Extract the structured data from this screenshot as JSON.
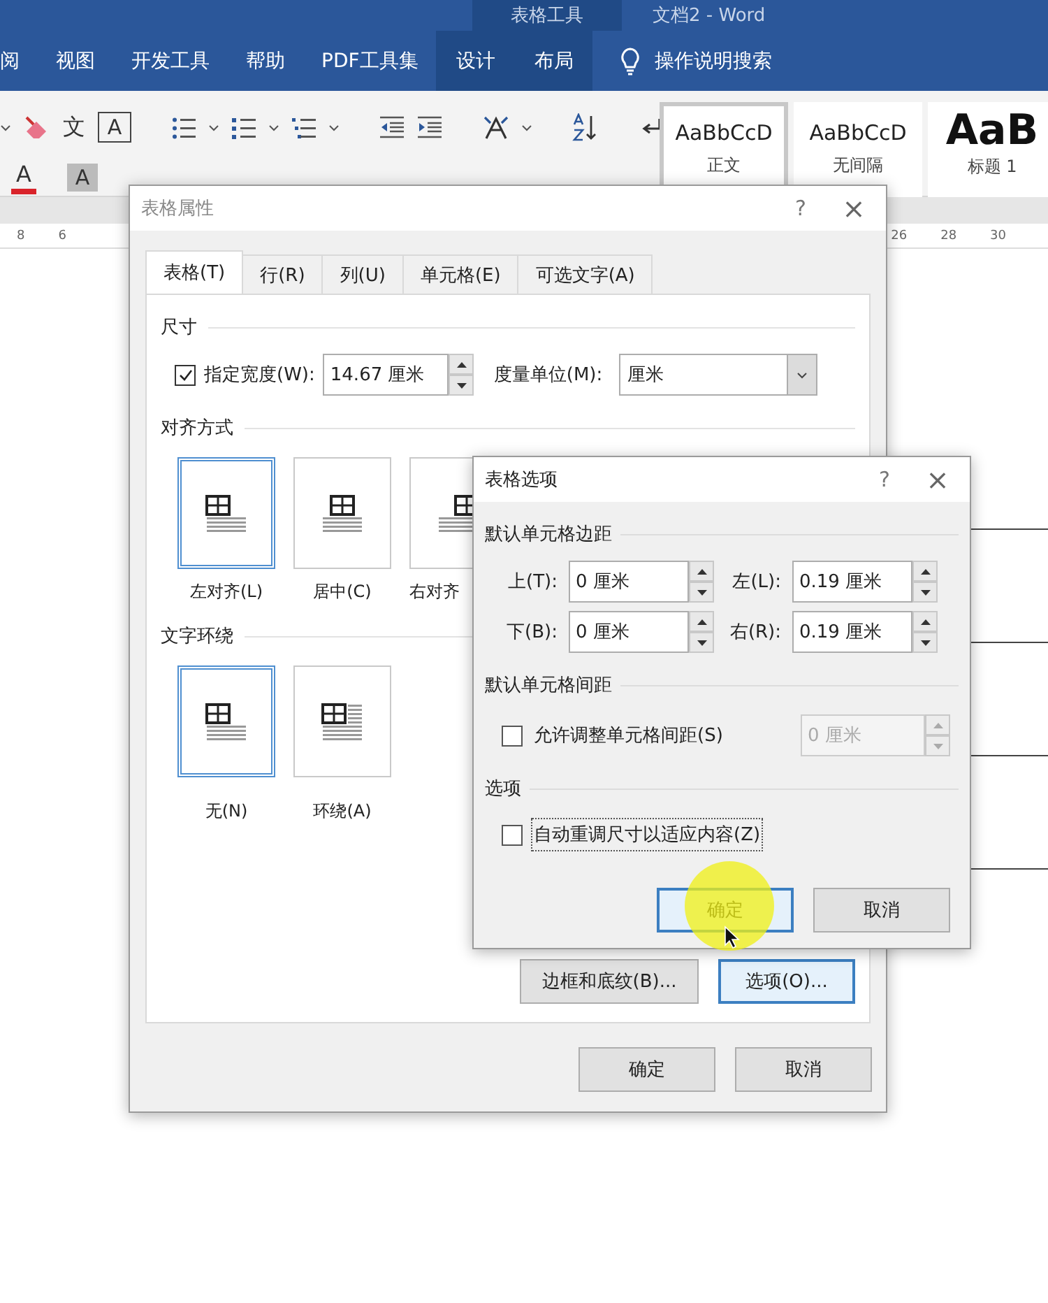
{
  "title_bar": {
    "context_label": "表格工具",
    "title": "文档2 - Word"
  },
  "ribbon_tabs": [
    {
      "label": "阅",
      "contextual": false
    },
    {
      "label": "视图",
      "contextual": false
    },
    {
      "label": "开发工具",
      "contextual": false
    },
    {
      "label": "帮助",
      "contextual": false
    },
    {
      "label": "PDF工具集",
      "contextual": false
    },
    {
      "label": "设计",
      "contextual": true
    },
    {
      "label": "布局",
      "contextual": true
    }
  ],
  "tell_me": {
    "label": "操作说明搜索"
  },
  "ribbon_glyphs": [
    {
      "kind": "pinyin",
      "text": "文"
    },
    {
      "kind": "boxed",
      "text": "A"
    },
    {
      "kind": "font_color",
      "text": "A"
    },
    {
      "kind": "shaded",
      "text": "A"
    }
  ],
  "style_gallery": [
    {
      "sample": "AaBbCcD",
      "label": "正文",
      "kind": "body",
      "selected": true
    },
    {
      "sample": "AaBbCcD",
      "label": "无间隔",
      "kind": "body",
      "selected": false
    },
    {
      "sample": "AaB",
      "label": "标题 1",
      "kind": "heading",
      "selected": false
    }
  ],
  "ruler": {
    "left_numbers": [
      "8",
      "6"
    ],
    "right_numbers": [
      "26",
      "28",
      "30"
    ]
  },
  "table_properties": {
    "title": "表格属性",
    "active": false,
    "help": "?",
    "close": "×",
    "tabs": [
      {
        "label": "表格(T)",
        "selected": true
      },
      {
        "label": "行(R)",
        "selected": false
      },
      {
        "label": "列(U)",
        "selected": false
      },
      {
        "label": "单元格(E)",
        "selected": false
      },
      {
        "label": "可选文字(A)",
        "selected": false
      }
    ],
    "size": {
      "heading": "尺寸",
      "preferred_width": {
        "label": "指定宽度(W):",
        "checked": true,
        "value": "14.67 厘米"
      },
      "unit": {
        "label": "度量单位(M):",
        "value": "厘米"
      }
    },
    "alignment": {
      "heading": "对齐方式",
      "options": [
        {
          "label": "左对齐(L)",
          "kind": "left",
          "selected": true
        },
        {
          "label": "居中(C)",
          "kind": "center",
          "selected": false
        },
        {
          "label": "右对齐",
          "kind": "right",
          "selected": false
        }
      ]
    },
    "wrapping": {
      "heading": "文字环绕",
      "options": [
        {
          "label": "无(N)",
          "kind": "none",
          "selected": true
        },
        {
          "label": "环绕(A)",
          "kind": "around",
          "selected": false
        }
      ]
    },
    "tab_buttons": [
      {
        "label": "边框和底纹(B)...",
        "focused": false
      },
      {
        "label": "选项(O)...",
        "focused": true
      }
    ],
    "buttons": [
      {
        "label": "确定",
        "focused": false
      },
      {
        "label": "取消",
        "focused": false
      }
    ]
  },
  "table_options": {
    "title": "表格选项",
    "active": true,
    "help": "?",
    "close": "×",
    "margins": {
      "heading": "默认单元格边距",
      "fields": [
        {
          "label": "上(T):",
          "value": "0 厘米"
        },
        {
          "label": "左(L):",
          "value": "0.19 厘米"
        },
        {
          "label": "下(B):",
          "value": "0 厘米"
        },
        {
          "label": "右(R):",
          "value": "0.19 厘米"
        }
      ]
    },
    "spacing": {
      "heading": "默认单元格间距",
      "checkbox": {
        "label": "允许调整单元格间距(S)",
        "checked": false
      },
      "field": {
        "value": "0 厘米",
        "disabled": true
      }
    },
    "options": {
      "heading": "选项",
      "checkbox": {
        "label": "自动重调尺寸以适应内容(Z)",
        "checked": false,
        "focused": true
      }
    },
    "buttons": [
      {
        "label": "确定",
        "focused": true
      },
      {
        "label": "取消",
        "focused": false
      }
    ]
  }
}
